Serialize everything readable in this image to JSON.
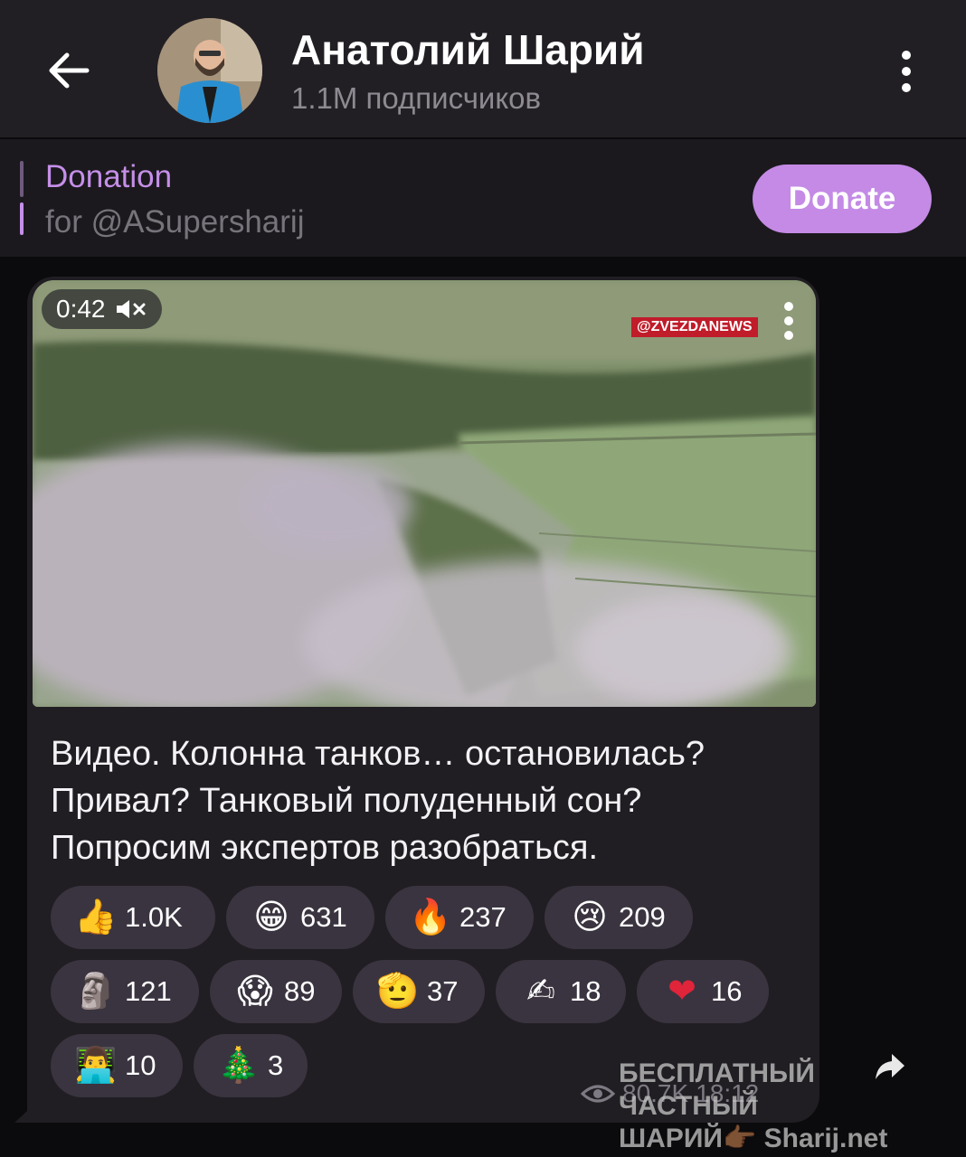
{
  "header": {
    "back_icon": "arrow-left-icon",
    "channel_name": "Анатолий Шарий",
    "subscribers": "1.1M подписчиков",
    "menu_icon": "more-vertical-icon"
  },
  "sponsor": {
    "title": "Donation",
    "subtitle": "for @ASupersharij",
    "button_label": "Donate",
    "accent_color": "#c48ae6"
  },
  "message": {
    "video": {
      "duration": "0:42",
      "mute_icon": "speaker-muted-icon",
      "source_tag": "@ZVEZDANEWS"
    },
    "caption_lines": [
      "Видео. Колонна танков… остановилась?",
      "Привал? Танковый полуденный сон?",
      "Попросим экспертов разобраться."
    ],
    "reactions": [
      {
        "emoji": "👍",
        "count": "1.0K"
      },
      {
        "emoji": "😁",
        "count": "631"
      },
      {
        "emoji": "🔥",
        "count": "237"
      },
      {
        "emoji": "😢",
        "count": "209"
      },
      {
        "emoji": "🗿",
        "count": "121"
      },
      {
        "emoji": "😱",
        "count": "89"
      },
      {
        "emoji": "🫡",
        "count": "37"
      },
      {
        "emoji": "✍",
        "count": "18"
      },
      {
        "emoji": "❤",
        "count": "16"
      },
      {
        "emoji": "👨‍💻",
        "count": "10"
      },
      {
        "emoji": "🎄",
        "count": "3"
      }
    ],
    "views": "80.7K",
    "time": "18:12",
    "views_icon": "eye-icon",
    "forward_icon": "share-arrow-icon"
  },
  "watermark": {
    "line1": "БЕСПЛАТНЫЙ  ЧАСТНЫЙ",
    "line2": "ШАРИЙ👉🏾 Sharij.net"
  }
}
